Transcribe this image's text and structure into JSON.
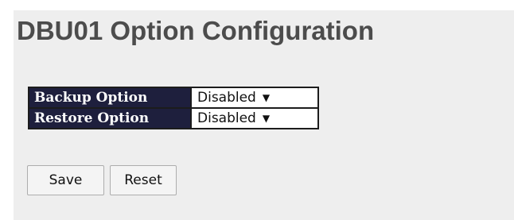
{
  "page": {
    "title": "DBU01 Option Configuration"
  },
  "options": [
    {
      "label": "Backup Option",
      "value": "Disabled"
    },
    {
      "label": "Restore Option",
      "value": "Disabled"
    }
  ],
  "buttons": {
    "save_label": "Save",
    "reset_label": "Reset"
  },
  "icons": {
    "dropdown": "chevron-down-icon"
  },
  "colors": {
    "panel_background": "#eeeeee",
    "title_text": "#4c4c4c",
    "label_cell_background": "#1e1f3d"
  }
}
